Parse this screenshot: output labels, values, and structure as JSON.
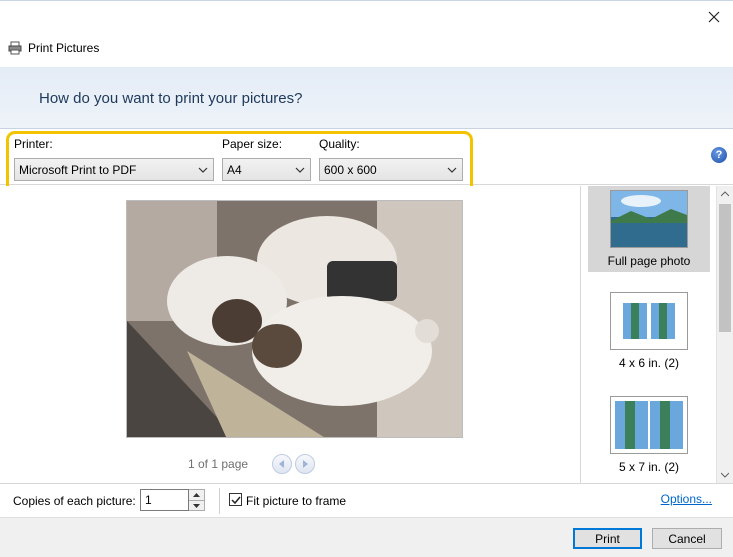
{
  "window": {
    "title": "Print Pictures",
    "close_icon": "close-icon",
    "app_icon": "printer-icon"
  },
  "banner": {
    "heading": "How do you want to print your pictures?"
  },
  "settings": {
    "printer": {
      "label": "Printer:",
      "value": "Microsoft Print to PDF"
    },
    "paper_size": {
      "label": "Paper size:",
      "value": "A4"
    },
    "quality": {
      "label": "Quality:",
      "value": "600 x 600"
    },
    "help_icon": "help-icon",
    "highlight_color": "#f3c300"
  },
  "preview": {
    "image_subject": "two ragdoll cats on a cat bed",
    "pager_text": "1 of 1 page",
    "prev_icon": "chevron-left-icon",
    "next_icon": "chevron-right-icon"
  },
  "layouts": [
    {
      "caption": "Full page photo",
      "selected": true
    },
    {
      "caption": "4 x 6 in. (2)",
      "selected": false
    },
    {
      "caption": "5 x 7 in. (2)",
      "selected": false
    }
  ],
  "options": {
    "copies_label": "Copies of each picture:",
    "copies_value": "1",
    "fit_label": "Fit picture to frame",
    "fit_checked": true,
    "options_link": "Options..."
  },
  "footer": {
    "print_label": "Print",
    "cancel_label": "Cancel"
  }
}
